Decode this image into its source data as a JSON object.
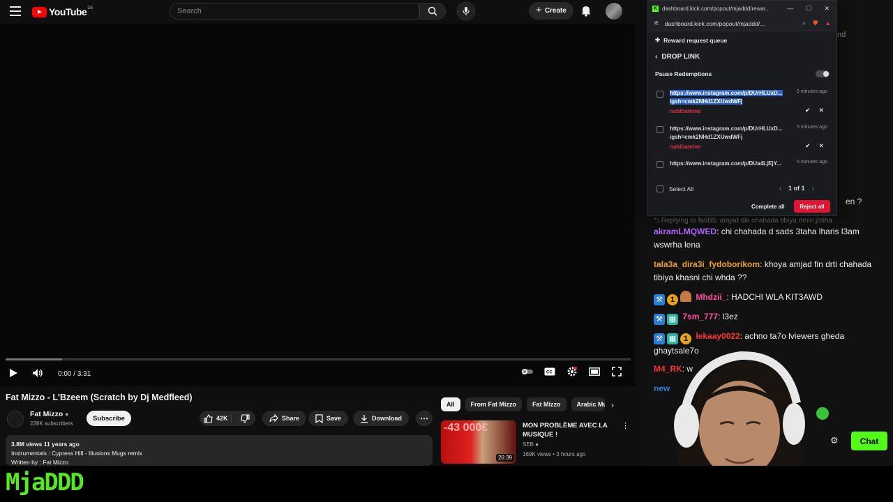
{
  "youtube": {
    "logo": "YouTube",
    "logo_country": "DE",
    "search_placeholder": "Search",
    "create_label": "Create",
    "player": {
      "time": "0:00 / 3:31",
      "progress": 0.0,
      "buffered": 0.09
    },
    "video_title": "Fat Mizzo - L'Bzeem (Scratch by Dj Medfleed)",
    "channel": {
      "name": "Fat Mizzo",
      "subscribers": "228K subscribers",
      "subscribe_label": "Subscribe"
    },
    "actions": {
      "likes": "42K",
      "share": "Share",
      "save": "Save",
      "download": "Download"
    },
    "description": {
      "meta": "3.8M views  11 years ago",
      "line1": "Instrumentals : Cypress Hill - Illusions Mugs remix",
      "line2": "Written by : Fat Mizzo"
    },
    "chips": [
      "All",
      "From Fat Mizzo",
      "Fat Mizzo",
      "Arabic Mu"
    ],
    "recommendation": {
      "title": "MON PROBLÈME AVEC LA MUSIQUE !",
      "channel": "SEB",
      "views": "169K views • 3 hours ago",
      "duration": "26:39",
      "thumb_text": "-43 000€"
    }
  },
  "popout": {
    "url_title": "dashboard.kick.com/popout/mjaddd/rewar...",
    "url": "dashboard.kick.com/popout/mjaddd/...",
    "section": "Reward request queue",
    "back_label": "DROP LINK",
    "pause_label": "Pause Redemptions",
    "requests": [
      {
        "link": "https://www.instagram.com/p/DUrHLUxD... igsh=cmk2NHd1ZXUwdWFj",
        "age": "5 minutes ago",
        "user": "nabibamine",
        "selected": true
      },
      {
        "link": "https://www.instagram.com/p/DUrHLUxD... igsh=cmk2NHd1ZXUwdWFj",
        "age": "5 minutes ago",
        "user": "nabibamine",
        "selected": false
      },
      {
        "link": "https://www.instagram.com/p/DUa4LjEjY...",
        "age": "5 minutes ago",
        "user": "",
        "selected": false
      }
    ],
    "select_all": "Select All",
    "pager": "1 of 1",
    "complete_all": "Complete all",
    "reject_all": "Reject all"
  },
  "chat": {
    "peek_top": "tnd",
    "peek_question": "en ?",
    "reply_context": "Replying to fatiB5: amjad dik chahada tibiya mnin jbtiha",
    "messages": [
      {
        "user": "akramLMQWED",
        "color": "#b266ff",
        "text": "chi chahada d sads 3taha lharis l3am wswrha lena",
        "badges": []
      },
      {
        "user": "tala3a_dira3i_fydoborikom",
        "color": "#f0a020",
        "text": "khoya amjad fin drti chahada tibiya khasni chi whda ??",
        "badges": []
      },
      {
        "user": "Mhdzii_",
        "color": "#ff4da0",
        "text": "HADCHI WLA KIT3AWD",
        "badges": [
          "pin",
          "one",
          "person"
        ]
      },
      {
        "user": "7sm_777",
        "color": "#ff4da0",
        "text": "l3ez",
        "badges": [
          "pin",
          "gift"
        ]
      },
      {
        "user": "lekaay0022",
        "color": "#ff3030",
        "text": "achno ta7o lviewers gheda ghaytsale7o",
        "badges": [
          "pin",
          "gift",
          "one"
        ]
      },
      {
        "user": "M4_RK",
        "color": "#ff3030",
        "text": "w",
        "badges": []
      },
      {
        "user": "new",
        "color": "#2b7fd6",
        "text": "",
        "badges": []
      }
    ],
    "chat_button": "Chat"
  },
  "overlay": {
    "brand": "MjaDDD"
  },
  "colors": {
    "kick_green": "#53fc18",
    "reject_red": "#e0152f",
    "yt_red": "#ff0000"
  }
}
